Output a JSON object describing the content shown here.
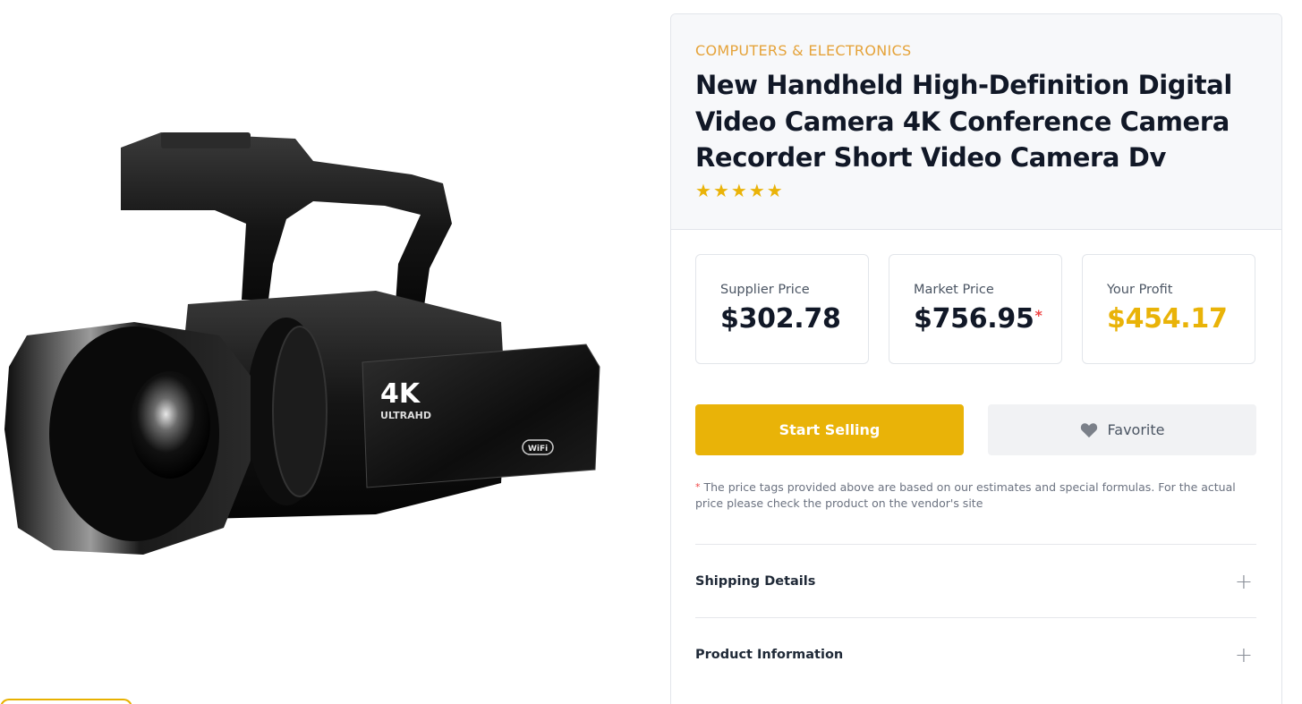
{
  "product": {
    "category": "COMPUTERS & ELECTRONICS",
    "title": "New Handheld High-Definition Digital Video Camera 4K Conference Camera Recorder Short Video Camera Dv",
    "rating": 5,
    "star_glyph": "★",
    "image": {
      "badge_main": "4K",
      "badge_sub": "ULTRAHD",
      "wifi_label": "WiFi"
    }
  },
  "prices": {
    "supplier": {
      "label": "Supplier Price",
      "value": "$302.78"
    },
    "market": {
      "label": "Market Price",
      "value": "$756.95",
      "asterisk": "*"
    },
    "profit": {
      "label": "Your Profit",
      "value": "$454.17"
    }
  },
  "actions": {
    "start_selling": "Start Selling",
    "favorite": "Favorite",
    "favorite_icon": "heart-icon"
  },
  "disclaimer": {
    "asterisk": "*",
    "text": " The price tags provided above are based on our estimates and special formulas. For the actual price please check the product on the vendor's site"
  },
  "accordion": [
    {
      "label": "Shipping Details",
      "icon": "plus-icon",
      "glyph": "+"
    },
    {
      "label": "Product Information",
      "icon": "plus-icon",
      "glyph": "+"
    }
  ],
  "colors": {
    "accent": "#e9b308",
    "category": "#e5a33a",
    "asterisk": "#ef4444"
  }
}
